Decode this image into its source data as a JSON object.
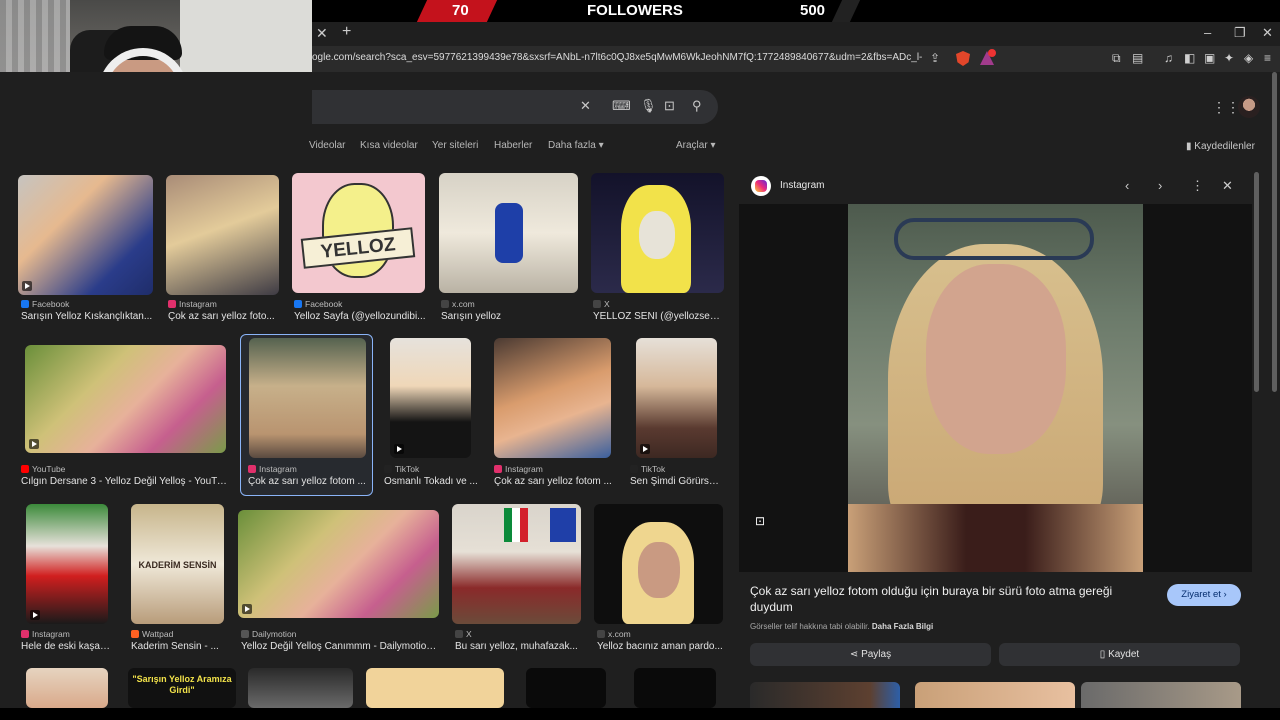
{
  "overlay": {
    "count_left": "70",
    "label": "FOLLOWERS",
    "count_right": "500"
  },
  "browser": {
    "tab_close": "✕",
    "new_tab": "+",
    "url": "ogle.com/search?sca_esv=5977621399439e78&sxsrf=ANbL-n7lt6c0QJ8xe5qMwM6WkJeohNM7fQ:1772489840677&udm=2&fbs=ADc_l-ZKoNEV9...",
    "window_min": "–",
    "window_max": "❐",
    "window_close": "✕"
  },
  "search": {
    "clear": "✕",
    "filters": [
      "Videolar",
      "Kısa videolar",
      "Yer siteleri",
      "Haberler",
      "Daha fazla",
      "Araçlar"
    ],
    "saved": "Kaydedilenler"
  },
  "results": [
    {
      "source": "Facebook",
      "title": "Sarışın Yelloz Kıskançlıktan...",
      "src_color": "#1877f2"
    },
    {
      "source": "Instagram",
      "title": "Çok az sarı yelloz foto...",
      "src_color": "#e1306c"
    },
    {
      "source": "Facebook",
      "title": "Yelloz Sayfa (@yellozundibi...",
      "src_color": "#1877f2"
    },
    {
      "source": "x.com",
      "title": "Sarışın yelloz",
      "src_color": "#444444"
    },
    {
      "source": "X",
      "title": "YELLOZ SENİ (@yellozsen...",
      "src_color": "#444444"
    },
    {
      "source": "YouTube",
      "title": "Cılgın Dersane 3 - Yelloz Değil Yelloş - YouTube",
      "src_color": "#ff0000"
    },
    {
      "source": "Instagram",
      "title": "Çok az sarı yelloz fotom ...",
      "src_color": "#e1306c"
    },
    {
      "source": "TikTok",
      "title": "Osmanlı Tokadı ve ...",
      "src_color": "#222222"
    },
    {
      "source": "Instagram",
      "title": "Çok az sarı yelloz fotom ...",
      "src_color": "#e1306c"
    },
    {
      "source": "TikTok",
      "title": "Sen Şimdi Görürsü...",
      "src_color": "#222222"
    },
    {
      "source": "Instagram",
      "title": "Hele de eski kaşarl...",
      "src_color": "#e1306c"
    },
    {
      "source": "Wattpad",
      "title": "Kaderim Sensin - ...",
      "src_color": "#ff6122"
    },
    {
      "source": "Dailymotion",
      "title": "Yelloz Değil Yelloş Canımmm - Dailymotion...",
      "src_color": "#555555"
    },
    {
      "source": "X",
      "title": "Bu sarı yelloz, muhafazak...",
      "src_color": "#444444"
    },
    {
      "source": "x.com",
      "title": "Yelloz bacınız aman pardo...",
      "src_color": "#444444"
    }
  ],
  "thumb_texts": {
    "yelloz_sign": "YELLOZ",
    "kaderim": "KADERİM SENSİN",
    "aramiza": "\"Sarışın Yelloz Aramıza Girdi\""
  },
  "panel": {
    "source": "Instagram",
    "title": "Çok az sarı yelloz fotom olduğu için buraya bir sürü foto atma gereği duydum",
    "visit": "Ziyaret et",
    "copyright": "Görseller telif hakkına tabi olabilir.",
    "learn_more": "Daha Fazla Bilgi",
    "share": "Paylaş",
    "save": "Kaydet"
  }
}
